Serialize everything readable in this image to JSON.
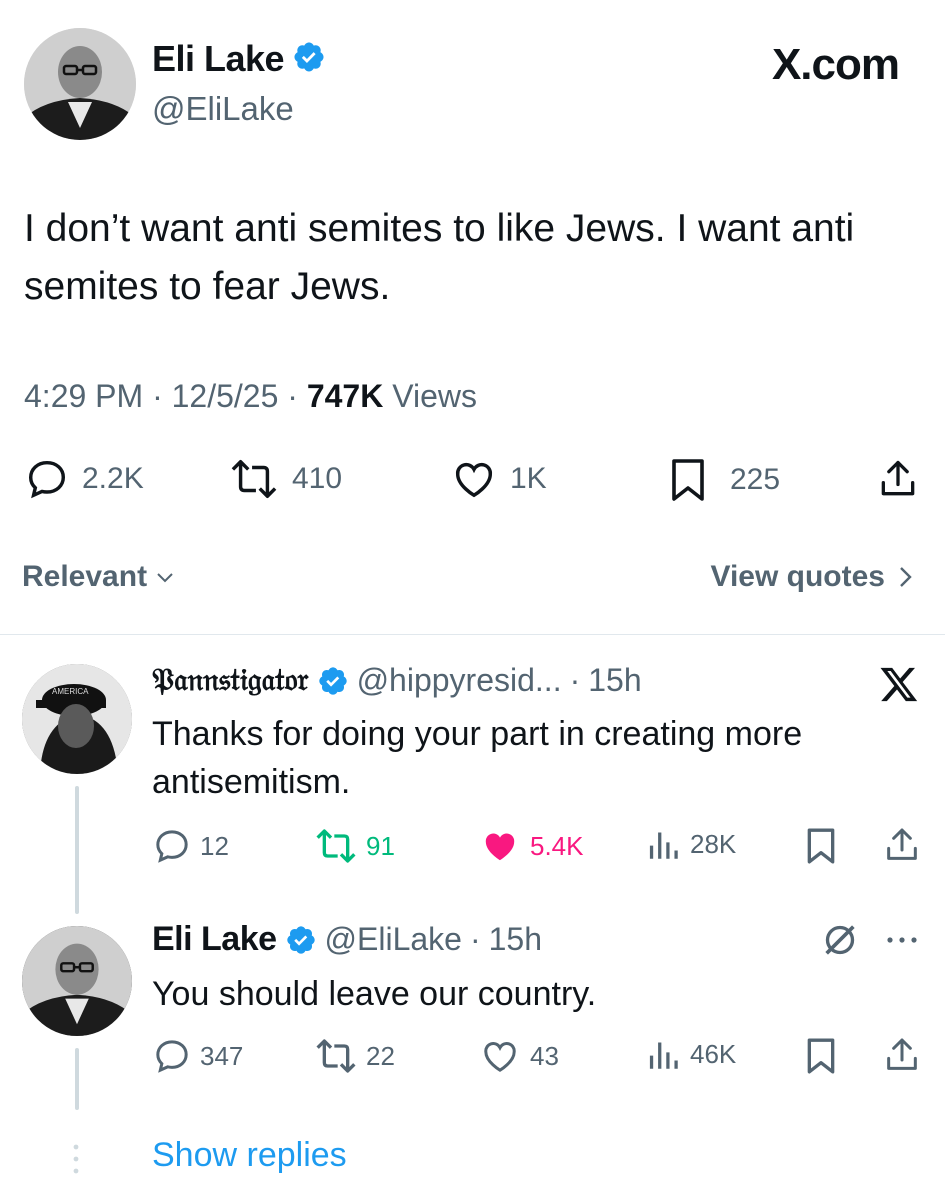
{
  "main_tweet": {
    "author_name": "Eli Lake",
    "author_handle": "@EliLake",
    "site_label": "X.com",
    "text": "I don’t want anti semites to like Jews. I want anti semites to fear Jews.",
    "time": "4:29 PM",
    "date": "12/5/25",
    "views_count": "747K",
    "views_label": "Views",
    "stats": {
      "replies": "2.2K",
      "reposts": "410",
      "likes": "1K",
      "bookmarks": "225"
    }
  },
  "sort_bar": {
    "relevant_label": "Relevant",
    "view_quotes_label": "View quotes"
  },
  "reply_1": {
    "author_name": "𝔓𝔞𝔫𝔫𝔰𝔱𝔦𝔤𝔞𝔱𝔬𝔯",
    "author_handle": "@hippyresid...",
    "age": "15h",
    "text": "Thanks for doing your part in creating more antisemitism.",
    "stats": {
      "replies": "12",
      "reposts": "91",
      "likes": "5.4K",
      "views": "28K"
    },
    "colors": {
      "repost": "#00ba7c",
      "like": "#f91880"
    }
  },
  "reply_2": {
    "author_name": "Eli Lake",
    "author_handle": "@EliLake",
    "age": "15h",
    "text": "You should leave our country.",
    "stats": {
      "replies": "347",
      "reposts": "22",
      "likes": "43",
      "views": "46K"
    }
  },
  "show_replies_label": "Show replies",
  "colors": {
    "verified": "#1d9bf0",
    "link": "#1d9bf0",
    "muted": "#536471"
  }
}
